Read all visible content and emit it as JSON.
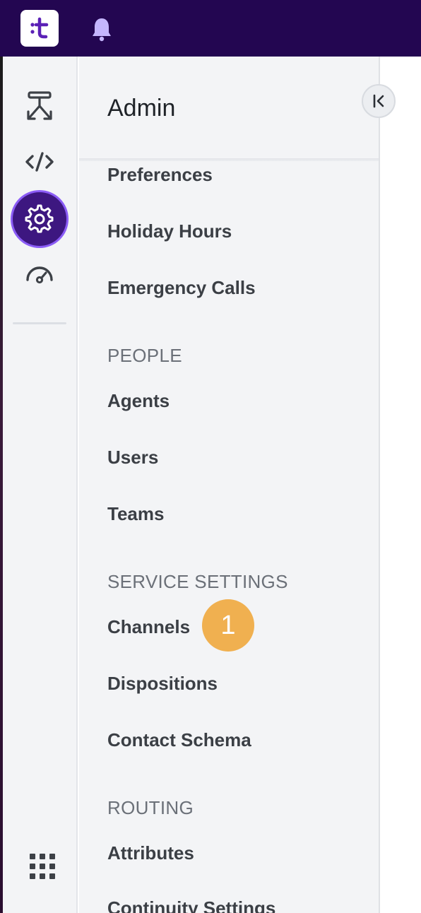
{
  "app": {
    "logo_text": ":t",
    "brand_color": "#230651",
    "accent_color": "#3d1780"
  },
  "topbar": {
    "icons": [
      "logo-icon",
      "bell-icon"
    ]
  },
  "rail": {
    "items": [
      {
        "name": "flow-icon",
        "active": false
      },
      {
        "name": "code-icon",
        "active": false
      },
      {
        "name": "gear-icon",
        "active": true
      },
      {
        "name": "dashboard-icon",
        "active": false
      }
    ],
    "bottom_icon": "apps-grid-icon"
  },
  "panel": {
    "title": "Admin",
    "collapse_icon": "collapse-left-icon",
    "items": [
      {
        "label": "Preferences"
      },
      {
        "label": "Holiday Hours"
      },
      {
        "label": "Emergency Calls"
      }
    ],
    "sections": [
      {
        "heading": "PEOPLE",
        "items": [
          {
            "label": "Agents"
          },
          {
            "label": "Users"
          },
          {
            "label": "Teams"
          }
        ]
      },
      {
        "heading": "SERVICE SETTINGS",
        "items": [
          {
            "label": "Channels",
            "badge": "1"
          },
          {
            "label": "Dispositions"
          },
          {
            "label": "Contact Schema"
          }
        ]
      },
      {
        "heading": "ROUTING",
        "items": [
          {
            "label": "Attributes"
          },
          {
            "label": "Continuity Settings"
          }
        ]
      }
    ]
  },
  "badge_color": "#f0b050"
}
